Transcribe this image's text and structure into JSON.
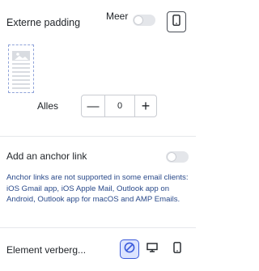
{
  "padding": {
    "title": "Externe padding",
    "more_label": "Meer",
    "all_label": "Alles",
    "value": "0",
    "minus": "—",
    "plus": "+"
  },
  "anchor": {
    "title": "Add an anchor link",
    "info": "Anchor links are not supported in some email clients: iOS Gmail app, iOS Apple Mail, Outlook app on Android, Outlook app for macOS and AMP Emails."
  },
  "visibility": {
    "title": "Element verberg..."
  },
  "colors": {
    "accent": "#3b5bdb",
    "accent_bg": "#dce4ff",
    "toggle_off": "#e4e6ea"
  },
  "icons": [
    "mobile-icon",
    "image-placeholder-icon",
    "no-entry-icon",
    "desktop-icon"
  ]
}
